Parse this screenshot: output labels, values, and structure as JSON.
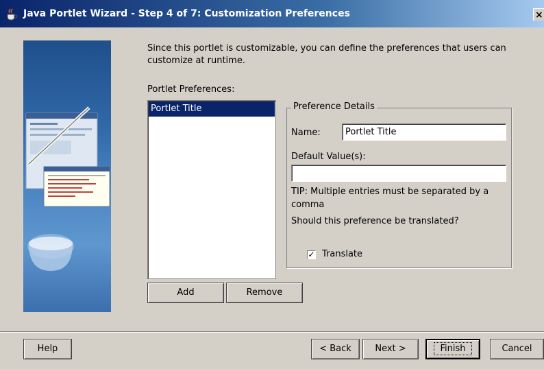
{
  "window": {
    "title": "Java Portlet Wizard - Step 4 of 7: Customization Preferences",
    "close_glyph": "×"
  },
  "intro_text": "Since this portlet is customizable, you can define the preferences that users can customize at runtime.",
  "preferences_label": "Portlet Preferences:",
  "preferences_list": [
    {
      "label": "Portlet Title",
      "selected": true
    }
  ],
  "details": {
    "group_title": "Preference Details",
    "name_label": "Name:",
    "name_value": "Portlet Title",
    "default_label": "Default Value(s):",
    "default_value": "",
    "tip": "TIP: Multiple entries must be separated by a comma",
    "translate_question": "Should this preference be translated?",
    "translate_label": "Translate",
    "translate_checked": true,
    "checkmark": "✓"
  },
  "list_buttons": {
    "add": "Add",
    "remove": "Remove"
  },
  "footer": {
    "help": "Help",
    "back": "< Back",
    "next": "Next >",
    "finish": "Finish",
    "cancel": "Cancel"
  },
  "colors": {
    "title_bar": "#0a246a",
    "selection": "#0a246a",
    "dialog_bg": "#d4d0c8"
  }
}
